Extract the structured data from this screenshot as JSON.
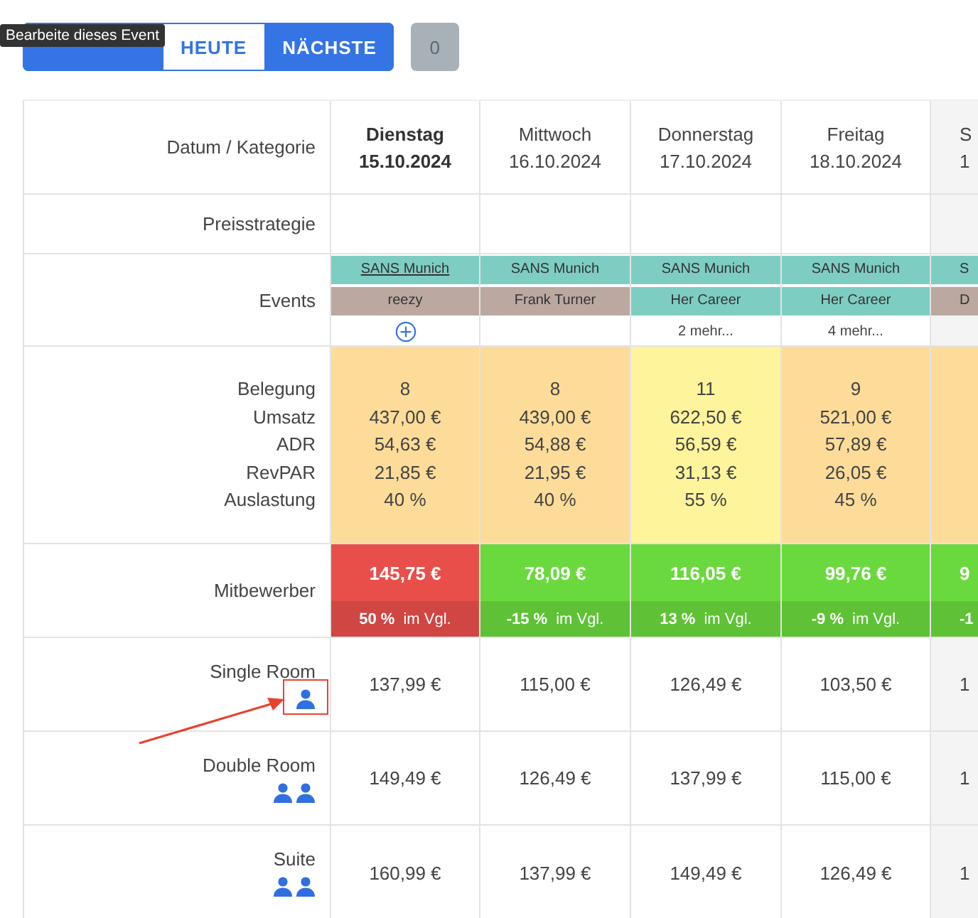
{
  "tooltip": "Bearbeite dieses Event",
  "nav": {
    "buttons": [
      {
        "selected": false
      },
      {
        "label": "HEUTE",
        "selected": true
      },
      {
        "label": "NÄCHSTE",
        "selected": false
      }
    ],
    "counter": "0"
  },
  "table": {
    "header_label": "Datum / Kategorie",
    "price_strategy_label": "Preisstrategie",
    "events_label": "Events",
    "stat_labels": [
      "Belegung",
      "Umsatz",
      "ADR",
      "RevPAR",
      "Auslastung"
    ],
    "competitor_label": "Mitbewerber",
    "days": [
      {
        "weekday": "Dienstag",
        "date": "15.10.2024",
        "today": true,
        "events": [
          {
            "name": "SANS Munich",
            "color": "#7ecdc3",
            "hovered": true
          },
          {
            "name": "reezy",
            "color": "#bba8a0",
            "hovered": false
          }
        ],
        "add": true,
        "stats": {
          "color": "#fddc9a",
          "belegung": "8",
          "umsatz": "437,00 €",
          "adr": "54,63 €",
          "revpar": "21,85 €",
          "auslastung": "40 %"
        },
        "competitor": {
          "price": "145,75 €",
          "diff": "50 %",
          "compare": "im Vgl.",
          "color": "#e84f4b"
        }
      },
      {
        "weekday": "Mittwoch",
        "date": "16.10.2024",
        "today": false,
        "events": [
          {
            "name": "SANS Munich",
            "color": "#7ecdc3",
            "hovered": false
          },
          {
            "name": "Frank Turner",
            "color": "#bba8a0",
            "hovered": false
          }
        ],
        "add": false,
        "stats": {
          "color": "#fddc9a",
          "belegung": "8",
          "umsatz": "439,00 €",
          "adr": "54,88 €",
          "revpar": "21,95 €",
          "auslastung": "40 %"
        },
        "competitor": {
          "price": "78,09 €",
          "diff": "-15 %",
          "compare": "im Vgl.",
          "color": "#6ad93d"
        }
      },
      {
        "weekday": "Donnerstag",
        "date": "17.10.2024",
        "today": false,
        "events": [
          {
            "name": "SANS Munich",
            "color": "#7ecdc3",
            "hovered": false
          },
          {
            "name": "Her Career",
            "color": "#7ecdc3",
            "hovered": false
          }
        ],
        "add": false,
        "more": "2 mehr...",
        "stats": {
          "color": "#fef49c",
          "belegung": "11",
          "umsatz": "622,50 €",
          "adr": "56,59 €",
          "revpar": "31,13 €",
          "auslastung": "55 %"
        },
        "competitor": {
          "price": "116,05 €",
          "diff": "13 %",
          "compare": "im Vgl.",
          "color": "#6ad93d"
        }
      },
      {
        "weekday": "Freitag",
        "date": "18.10.2024",
        "today": false,
        "events": [
          {
            "name": "SANS Munich",
            "color": "#7ecdc3",
            "hovered": false
          },
          {
            "name": "Her Career",
            "color": "#7ecdc3",
            "hovered": false
          }
        ],
        "add": false,
        "more": "4 mehr...",
        "stats": {
          "color": "#fddc9a",
          "belegung": "9",
          "umsatz": "521,00 €",
          "adr": "57,89 €",
          "revpar": "26,05 €",
          "auslastung": "45 %"
        },
        "competitor": {
          "price": "99,76 €",
          "diff": "-9 %",
          "compare": "im Vgl.",
          "color": "#6ad93d"
        }
      },
      {
        "weekday": "S",
        "date": "1",
        "today": false,
        "events": [
          {
            "name": "S",
            "color": "#7ecdc3",
            "hovered": false
          },
          {
            "name": "D",
            "color": "#bba8a0",
            "hovered": false
          }
        ],
        "add": false,
        "stats": {
          "color": "#fddc9a"
        },
        "competitor": {
          "price": "9",
          "diff": "-1",
          "color": "#6ad93d"
        }
      }
    ],
    "rooms": [
      {
        "name": "Single Room",
        "kind": "single",
        "prices": [
          "137,99 €",
          "115,00 €",
          "126,49 €",
          "103,50 €",
          "1"
        ]
      },
      {
        "name": "Double Room",
        "kind": "double",
        "prices": [
          "149,49 €",
          "126,49 €",
          "137,99 €",
          "115,00 €",
          "1"
        ]
      },
      {
        "name": "Suite",
        "kind": "double",
        "prices": [
          "160,99 €",
          "137,99 €",
          "149,49 €",
          "126,49 €",
          "1"
        ]
      }
    ]
  },
  "annotation": {
    "highlight": true
  }
}
